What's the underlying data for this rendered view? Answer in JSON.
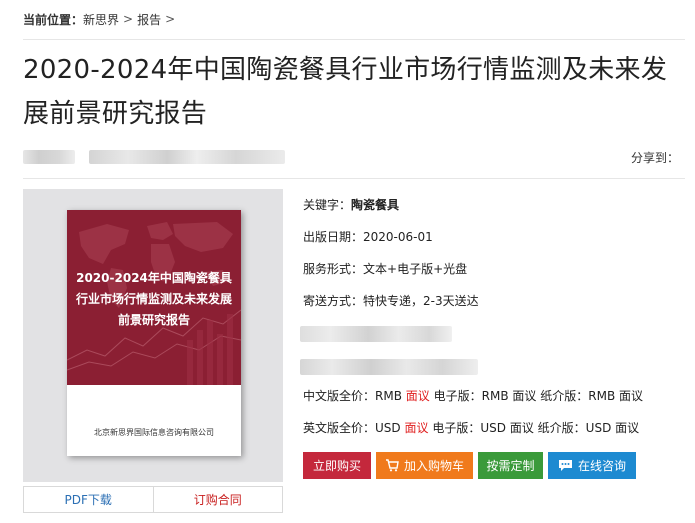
{
  "breadcrumb": {
    "label": "当前位置：",
    "items": [
      "新思界",
      "报告"
    ],
    "sep": ">"
  },
  "title": "2020-2024年中国陶瓷餐具行业市场行情监测及未来发展前景研究报告",
  "share_label": "分享到：",
  "cover": {
    "title": "2020-2024年中国陶瓷餐具行业市场行情监测及未来发展前景研究报告",
    "publisher": "北京新思界国际信息咨询有限公司",
    "color": "#8b1f33"
  },
  "cover_actions": {
    "pdf": "PDF下载",
    "contract": "订购合同"
  },
  "info": {
    "keyword_label": "关键字：",
    "keyword": "陶瓷餐具",
    "date_label": "出版日期：",
    "date": "2020-06-01",
    "service_label": "服务形式：",
    "service": "文本+电子版+光盘",
    "delivery_label": "寄送方式：",
    "delivery": "特快专递，2-3天送达"
  },
  "price_cn": {
    "label": "中文版全价：",
    "rmb1": "RMB",
    "neg1": "面议",
    "ebook_label": "电子版：",
    "rmb2": "RMB",
    "neg2": "面议",
    "paper_label": "纸介版：",
    "rmb3": "RMB",
    "neg3": "面议"
  },
  "price_en": {
    "label": "英文版全价：",
    "usd1": "USD",
    "neg1": "面议",
    "ebook_label": "电子版：",
    "usd2": "USD",
    "neg2": "面议",
    "paper_label": "纸介版：",
    "usd3": "USD",
    "neg3": "面议"
  },
  "buttons": {
    "buy": "立即购买",
    "cart": "加入购物车",
    "custom": "按需定制",
    "consult": "在线咨询"
  },
  "colors": {
    "accent_red": "#e02020",
    "buy": "#c4283c",
    "cart": "#f07a1c",
    "custom": "#3a9a3a",
    "consult": "#1d8ad1"
  }
}
